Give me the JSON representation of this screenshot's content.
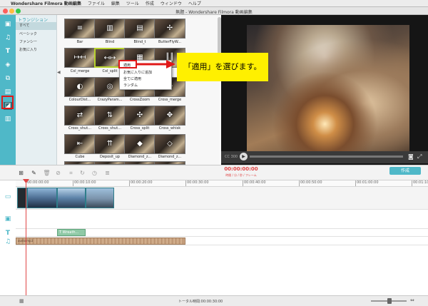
{
  "menubar": {
    "app": "Wondershare Filmora 動画編集",
    "items": [
      "ファイル",
      "編集",
      "ツール",
      "作成",
      "ウィンドウ",
      "ヘルプ"
    ]
  },
  "window_title": "無題 - Wondershare Filmora 動画編集",
  "categories": {
    "header": "トランジション",
    "items": [
      "すべて",
      "ベーシック",
      "ファンシー",
      "お気に入り"
    ]
  },
  "transitions": [
    [
      "Bar",
      "Blind",
      "Blind_t",
      "ButterFlyW..."
    ],
    [
      "Col_merge",
      "Col_split",
      "",
      ""
    ],
    [
      "ColourDist...",
      "CrazyParam...",
      "CrossZoom",
      "Cross_merge"
    ],
    [
      "Cross_shut...",
      "Cross_shut...",
      "Cross_split",
      "Cross_whisk"
    ],
    [
      "Cube",
      "Deposit_up",
      "Diamond_z...",
      "Diamond_z..."
    ]
  ],
  "context_menu": {
    "items": [
      "適用",
      "お気に入りに追加",
      "全てに適用",
      "ランダム"
    ]
  },
  "callout": "「適用」を選びます。",
  "preview": {
    "time": "00:00:00:00",
    "time_label": "時間 / 分 / 秒 / フレーム",
    "counter": "CC 300"
  },
  "toolbar": {
    "export_label": "作成"
  },
  "ruler_ticks": [
    "00:00:00:00",
    "00:00:10:00",
    "00:00:20:00",
    "00:00:30:00",
    "00:00:40:00",
    "00:00:50:00",
    "00:01:00:00",
    "00:01:10:00"
  ],
  "text_clip": "Wreath...",
  "audio_clip": "audio.mp3",
  "status": {
    "total_time": "トータル時間:00:00:30:00"
  },
  "colors": {
    "accent": "#4fb8c8",
    "highlight": "#e01818",
    "callout": "#fff000",
    "playhead": "#e04545"
  }
}
